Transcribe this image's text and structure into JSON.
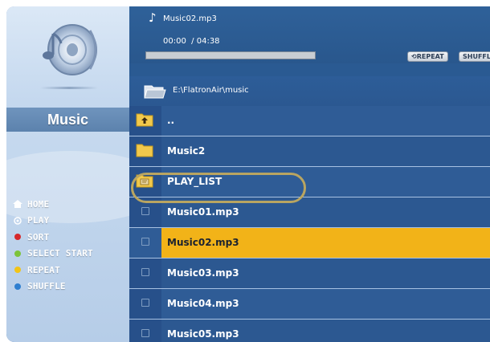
{
  "player": {
    "song_title": "Music02.mp3",
    "time": "00:00  / 04:38",
    "progress": 0,
    "repeat_label": "REPEAT",
    "shuffle_label": "SHUFFLE"
  },
  "path": "E:\\FlatronAir\\music",
  "sidebar": {
    "section_title": "Music",
    "menu": [
      {
        "label": "HOME",
        "icon": "home-icon",
        "color": "#ffffff"
      },
      {
        "label": "PLAY",
        "icon": "play-icon",
        "color": "#ffffff"
      },
      {
        "label": "SORT",
        "icon": "red-button-icon",
        "color": "#d6282b"
      },
      {
        "label": "SELECT START",
        "icon": "green-button-icon",
        "color": "#7cc33a"
      },
      {
        "label": "REPEAT",
        "icon": "yellow-button-icon",
        "color": "#f2c417"
      },
      {
        "label": "SHUFFLE",
        "icon": "blue-button-icon",
        "color": "#2f7fd0"
      }
    ]
  },
  "files": [
    {
      "name": "..",
      "icon": "parent-folder-icon"
    },
    {
      "name": "Music2",
      "icon": "folder-icon"
    },
    {
      "name": "PLAY_LIST",
      "icon": "playlist-folder-icon"
    },
    {
      "name": "Music01.mp3",
      "icon": "checkbox-icon"
    },
    {
      "name": "Music02.mp3",
      "icon": "checkbox-icon",
      "selected": true
    },
    {
      "name": "Music03.mp3",
      "icon": "checkbox-icon"
    },
    {
      "name": "Music04.mp3",
      "icon": "checkbox-icon"
    },
    {
      "name": "Music05.mp3",
      "icon": "checkbox-icon"
    }
  ],
  "colors": {
    "selection": "#f2b318",
    "row": "#2f5c96",
    "highlight_ring": "#b9a561"
  }
}
